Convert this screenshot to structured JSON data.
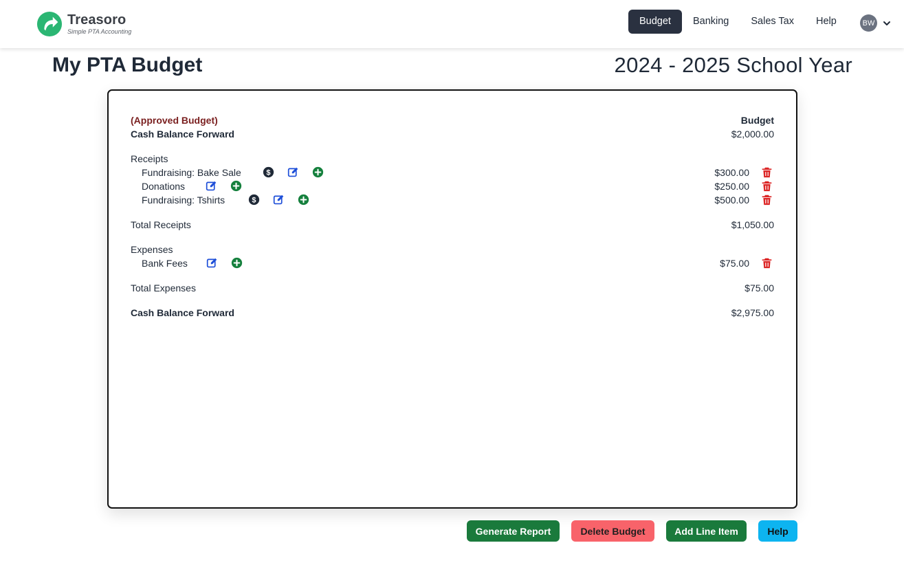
{
  "brand": {
    "name": "Treasoro",
    "tagline": "Simple PTA Accounting",
    "logo_icon": "treasoro-arrow-logo",
    "accent": "#2bb673"
  },
  "nav": {
    "items": [
      {
        "label": "Budget",
        "active": true
      },
      {
        "label": "Banking",
        "active": false
      },
      {
        "label": "Sales Tax",
        "active": false
      },
      {
        "label": "Help",
        "active": false
      }
    ],
    "user_initials": "BW"
  },
  "page": {
    "title": "My PTA Budget",
    "year": "2024 - 2025 School Year"
  },
  "budget": {
    "status": "(Approved Budget)",
    "column_header": "Budget",
    "opening_label": "Cash Balance Forward",
    "opening_amount": "$2,000.00",
    "receipts_label": "Receipts",
    "receipts": [
      {
        "name": "Fundraising: Bake Sale",
        "amount": "$300.00",
        "has_dollar_icon": true
      },
      {
        "name": "Donations",
        "amount": "$250.00",
        "has_dollar_icon": false
      },
      {
        "name": "Fundraising: Tshirts",
        "amount": "$500.00",
        "has_dollar_icon": true
      }
    ],
    "total_receipts_label": "Total Receipts",
    "total_receipts": "$1,050.00",
    "expenses_label": "Expenses",
    "expenses": [
      {
        "name": "Bank Fees",
        "amount": "$75.00",
        "has_dollar_icon": false
      }
    ],
    "total_expenses_label": "Total Expenses",
    "total_expenses": "$75.00",
    "closing_label": "Cash Balance Forward",
    "closing_amount": "$2,975.00"
  },
  "actions": {
    "generate_report": "Generate Report",
    "delete_budget": "Delete Budget",
    "add_line_item": "Add Line Item",
    "help": "Help"
  },
  "colors": {
    "nav_active_bg": "#2a3140",
    "edit_icon": "#1d4ed8",
    "add_icon": "#15803d",
    "trash_icon": "#dc2626",
    "dollar_icon": "#1f2937",
    "btn_green": "#1a7a3c",
    "btn_red": "#f8636a",
    "btn_blue": "#0db4f0"
  }
}
